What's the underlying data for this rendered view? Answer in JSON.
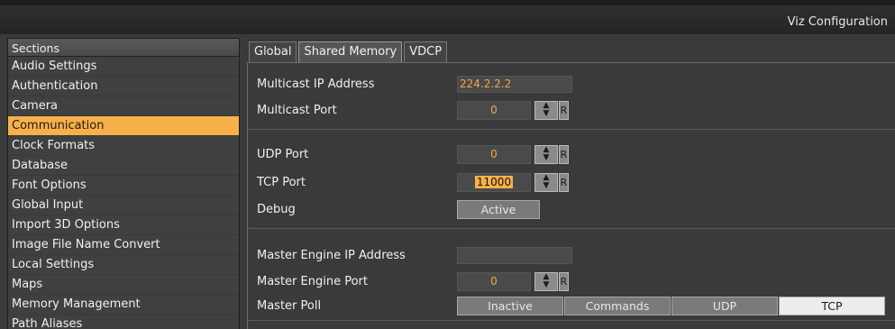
{
  "window": {
    "title": "Viz Configuration"
  },
  "sidebar": {
    "header": "Sections",
    "items": [
      {
        "label": "Audio Settings",
        "active": false
      },
      {
        "label": "Authentication",
        "active": false
      },
      {
        "label": "Camera",
        "active": false
      },
      {
        "label": "Communication",
        "active": true
      },
      {
        "label": "Clock Formats",
        "active": false
      },
      {
        "label": "Database",
        "active": false
      },
      {
        "label": "Font Options",
        "active": false
      },
      {
        "label": "Global Input",
        "active": false
      },
      {
        "label": "Import 3D Options",
        "active": false
      },
      {
        "label": "Image File Name Convert",
        "active": false
      },
      {
        "label": "Local Settings",
        "active": false
      },
      {
        "label": "Maps",
        "active": false
      },
      {
        "label": "Memory Management",
        "active": false
      },
      {
        "label": "Path Aliases",
        "active": false
      }
    ]
  },
  "tabs": [
    {
      "label": "Global",
      "active": false
    },
    {
      "label": "Shared Memory",
      "active": true
    },
    {
      "label": "VDCP",
      "active": false
    }
  ],
  "shared_memory": {
    "multicast_ip_label": "Multicast IP Address",
    "multicast_ip_value": "224.2.2.2",
    "multicast_port_label": "Multicast Port",
    "multicast_port_value": "0",
    "udp_port_label": "UDP Port",
    "udp_port_value": "0",
    "tcp_port_label": "TCP Port",
    "tcp_port_value": "11000",
    "debug_label": "Debug",
    "debug_value": "Active",
    "master_ip_label": "Master Engine IP Address",
    "master_ip_value": "",
    "master_port_label": "Master Engine Port",
    "master_port_value": "0",
    "master_poll_label": "Master Poll",
    "master_poll_options": [
      "Inactive",
      "Commands",
      "UDP",
      "TCP"
    ],
    "master_poll_selected": "TCP",
    "reset_label": "R",
    "spin_up": "▲",
    "spin_down": "▼"
  },
  "colors": {
    "accent": "#f8b04a",
    "value_text": "#f3a742"
  }
}
